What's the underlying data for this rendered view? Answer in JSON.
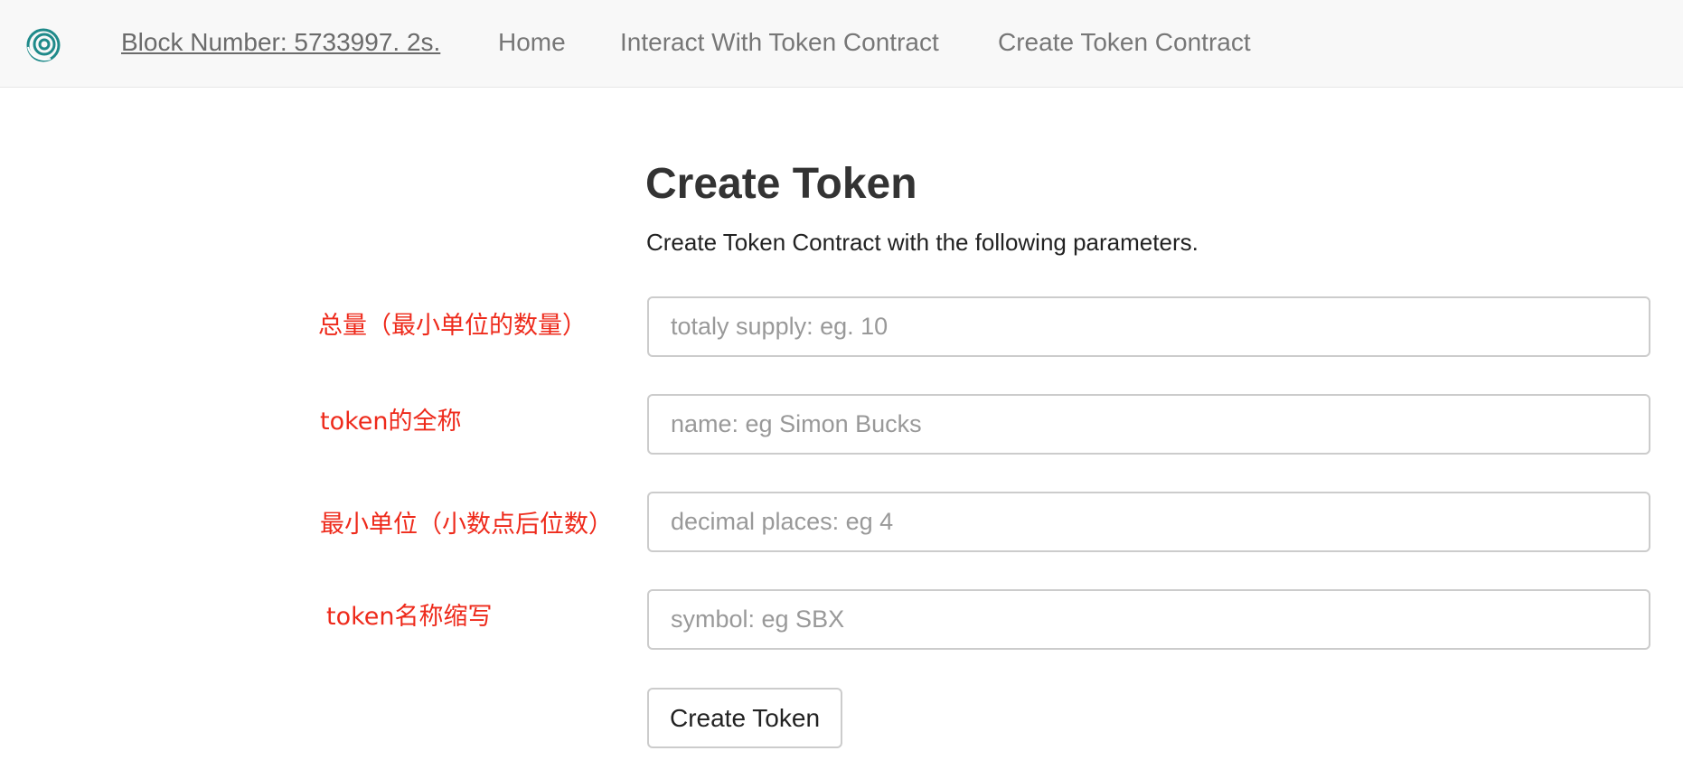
{
  "navbar": {
    "logo_icon": "spiral-logo-icon",
    "block_label": "Block Number: 5733997. 2s.",
    "links": [
      "Home",
      "Interact With Token Contract",
      "Create Token Contract"
    ]
  },
  "main": {
    "title": "Create Token",
    "description": "Create Token Contract with the following parameters."
  },
  "form": {
    "fields": [
      {
        "annotation": "总量（最小单位的数量）",
        "placeholder": "totaly supply: eg. 10",
        "value": ""
      },
      {
        "annotation": "token的全称",
        "placeholder": "name: eg Simon Bucks",
        "value": ""
      },
      {
        "annotation": "最小单位（小数点后位数）",
        "placeholder": "decimal places: eg 4",
        "value": ""
      },
      {
        "annotation": "token名称缩写",
        "placeholder": "symbol: eg SBX",
        "value": ""
      }
    ],
    "submit_label": "Create Token"
  },
  "colors": {
    "navbar_bg": "#f8f8f8",
    "nav_text": "#777777",
    "annotation": "#ee2a1b",
    "logo": "#1f8a8a"
  }
}
